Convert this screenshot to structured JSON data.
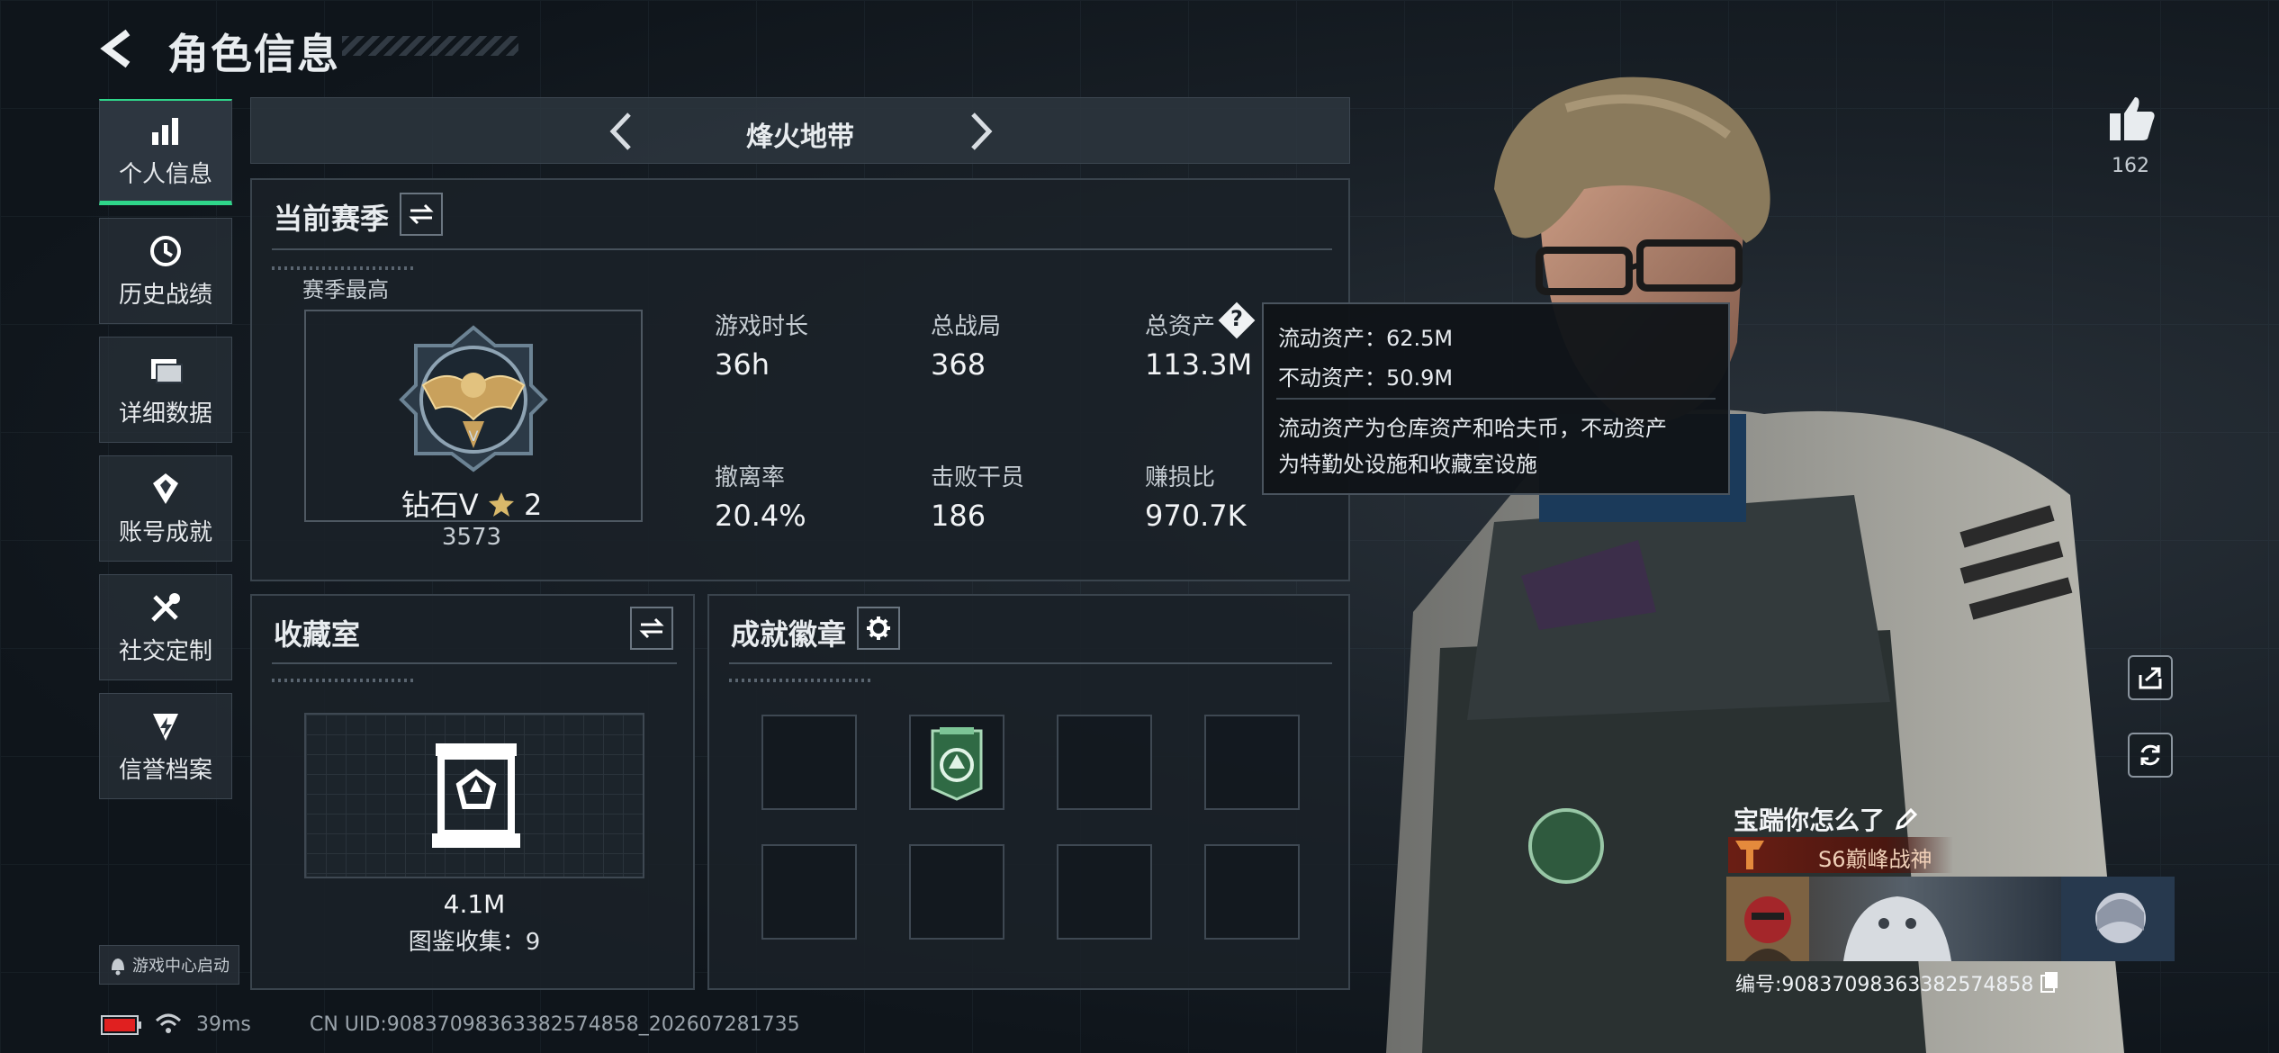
{
  "header": {
    "title": "角色信息"
  },
  "nav": [
    {
      "label": "个人信息",
      "icon": "bar-chart-icon",
      "active": true
    },
    {
      "label": "历史战绩",
      "icon": "history-icon"
    },
    {
      "label": "详细数据",
      "icon": "folder-icon"
    },
    {
      "label": "账号成就",
      "icon": "achievement-icon"
    },
    {
      "label": "社交定制",
      "icon": "wrench-icon"
    },
    {
      "label": "信誉档案",
      "icon": "shield-icon"
    }
  ],
  "notice": {
    "label": "游戏中心启动"
  },
  "mode": {
    "title": "烽火地带"
  },
  "season": {
    "title": "当前赛季",
    "best_label": "赛季最高",
    "rank": "钻石V",
    "stars": "2",
    "score": "3573",
    "stats": [
      {
        "label": "游戏时长",
        "value": "36h"
      },
      {
        "label": "总战局",
        "value": "368"
      },
      {
        "label": "总资产",
        "value": "113.3M"
      },
      {
        "label": "撤离率",
        "value": "20.4%"
      },
      {
        "label": "击败干员",
        "value": "186"
      },
      {
        "label": "赚损比",
        "value": "970.7K"
      }
    ]
  },
  "tooltip": {
    "liquid": "流动资产：62.5M",
    "fixed": "不动资产：50.9M",
    "desc1": "流动资产为仓库资产和哈夫币，不动资产",
    "desc2": "为特勤处设施和收藏室设施"
  },
  "collection": {
    "title": "收藏室",
    "value": "4.1M",
    "count_label": "图鉴收集：9"
  },
  "badges": {
    "title": "成就徽章",
    "slots": 8,
    "filled_index": 1
  },
  "status": {
    "ping": "39ms",
    "uid": "CN UID:9083709836338257485​8_202607281735"
  },
  "player": {
    "likes": "162",
    "name": "宝踹你怎么了",
    "rank_title": "S6巅峰战神",
    "id": "编号:908370983633825748​58"
  },
  "colors": {
    "accent": "#2fd68a",
    "battery": "#e02020",
    "rank": "#6b1e14"
  }
}
